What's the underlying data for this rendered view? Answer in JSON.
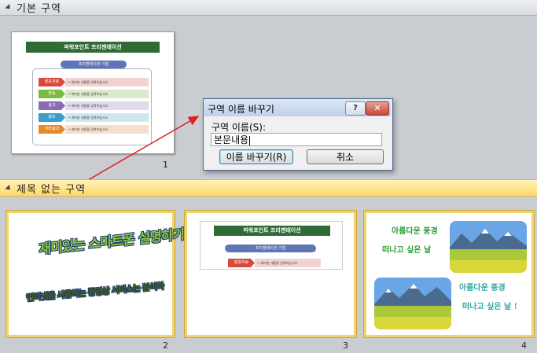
{
  "sections": [
    {
      "label": "기본 구역"
    },
    {
      "label": "제목 없는 구역"
    }
  ],
  "slides": [
    {
      "number": "1"
    },
    {
      "number": "2"
    },
    {
      "number": "3"
    },
    {
      "number": "4"
    }
  ],
  "ppt_slide": {
    "title": "파워포인트 프리젠테이션",
    "subtitle": "프리젠테이션 기법",
    "rows": [
      {
        "tag": "발표자료",
        "text": "• 여러분 내용을 입력하십시오.",
        "tag_color": "#d94a3a",
        "bar_color": "#f1d2d0"
      },
      {
        "tag": "방송",
        "text": "• 여러분 내용을 입력하십시오.",
        "tag_color": "#7dbb3f",
        "bar_color": "#dbe9cf"
      },
      {
        "tag": "광고",
        "text": "• 여러분 내용을 입력하십시오.",
        "tag_color": "#8a6bb5",
        "bar_color": "#e1d9ec"
      },
      {
        "tag": "홍보",
        "text": "• 여러분 내용을 입력하십시오.",
        "tag_color": "#3a9ec9",
        "bar_color": "#d2e6f0"
      },
      {
        "tag": "기타효과",
        "text": "• 여러분 내용을 입력하십시오.",
        "tag_color": "#e68a2e",
        "bar_color": "#f3e0cc"
      }
    ]
  },
  "wordart_slide": {
    "line1": "재미있는 스마트폰 설명하기",
    "line2": "인터넷을 사용하는 동영상 서비스는 분석하"
  },
  "text_slide": {
    "line1": "아름다운 풍경",
    "line2": "떠나고 싶은 날",
    "line3": "아름다운 풍경",
    "line4": "떠나고 싶은 날 !"
  },
  "dialog": {
    "title": "구역 이름 바꾸기",
    "help_label": "?",
    "close_label": "✕",
    "field_label": "구역 이름(S):",
    "field_value": "본문내용",
    "ok_label": "이름 바꾸기(R)",
    "cancel_label": "취소"
  },
  "colors": {
    "selected_section": "#ffd86a",
    "arrow": "#e02020",
    "accent_green": "#2f6b34"
  }
}
